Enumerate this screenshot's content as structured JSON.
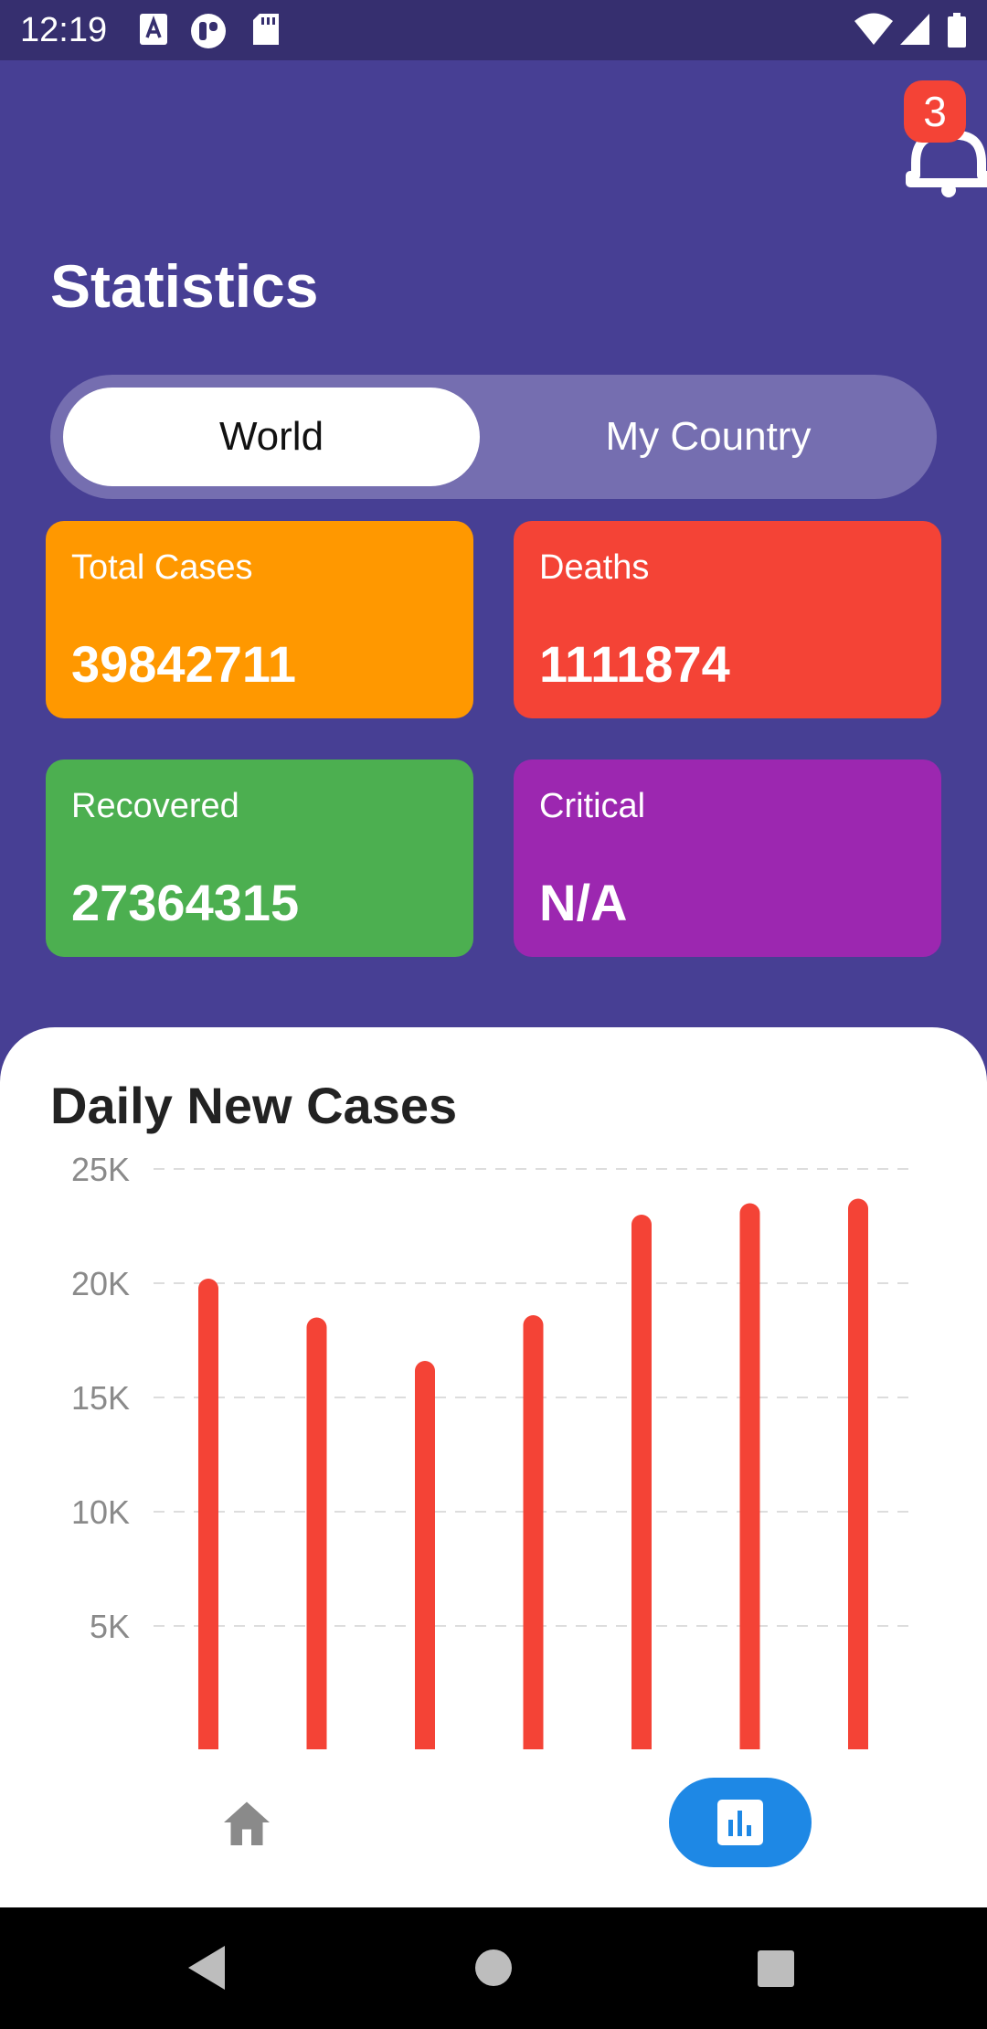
{
  "status_bar": {
    "time": "12:19",
    "left_icons": [
      "font-download-icon",
      "pocket-app-icon",
      "sd-card-icon"
    ],
    "right_icons": [
      "wifi-icon",
      "cell-signal-icon",
      "battery-icon"
    ]
  },
  "header": {
    "title": "Statistics",
    "notification_count": "3",
    "notification_icon": "bell-icon"
  },
  "toggle": {
    "options": [
      "World",
      "My Country"
    ],
    "selected": "World"
  },
  "stats": {
    "total_cases": {
      "label": "Total Cases",
      "value": "39842711",
      "color": "#ff9800"
    },
    "deaths": {
      "label": "Deaths",
      "value": "1111874",
      "color": "#f44336"
    },
    "recovered": {
      "label": "Recovered",
      "value": "27364315",
      "color": "#4caf50"
    },
    "critical": {
      "label": "Critical",
      "value": "N/A",
      "color": "#9c27b0"
    }
  },
  "chart_section": {
    "title": "Daily New Cases"
  },
  "chart_data": {
    "type": "bar",
    "values": [
      20200,
      18500,
      16600,
      18600,
      23000,
      23500,
      23700
    ],
    "yticks": [
      5000,
      10000,
      15000,
      20000,
      25000
    ],
    "ytick_labels": [
      "5K",
      "10K",
      "15K",
      "20K",
      "25K"
    ],
    "ylim": [
      0,
      25000
    ],
    "grid": "horizontal-dashed",
    "bar_color": "#f44336"
  },
  "bottom_nav": {
    "items": [
      {
        "name": "home",
        "icon": "home-icon",
        "active": false
      },
      {
        "name": "stats",
        "icon": "bar-chart-icon",
        "active": true
      }
    ],
    "active_color": "#1e88e5"
  },
  "system_nav": {
    "buttons": [
      "back-icon",
      "home-circle-icon",
      "recents-icon"
    ]
  },
  "colors": {
    "primary": "#473f94",
    "status_bar": "#362f6f",
    "toggle_track": "#756eb0",
    "badge": "#f44336"
  }
}
